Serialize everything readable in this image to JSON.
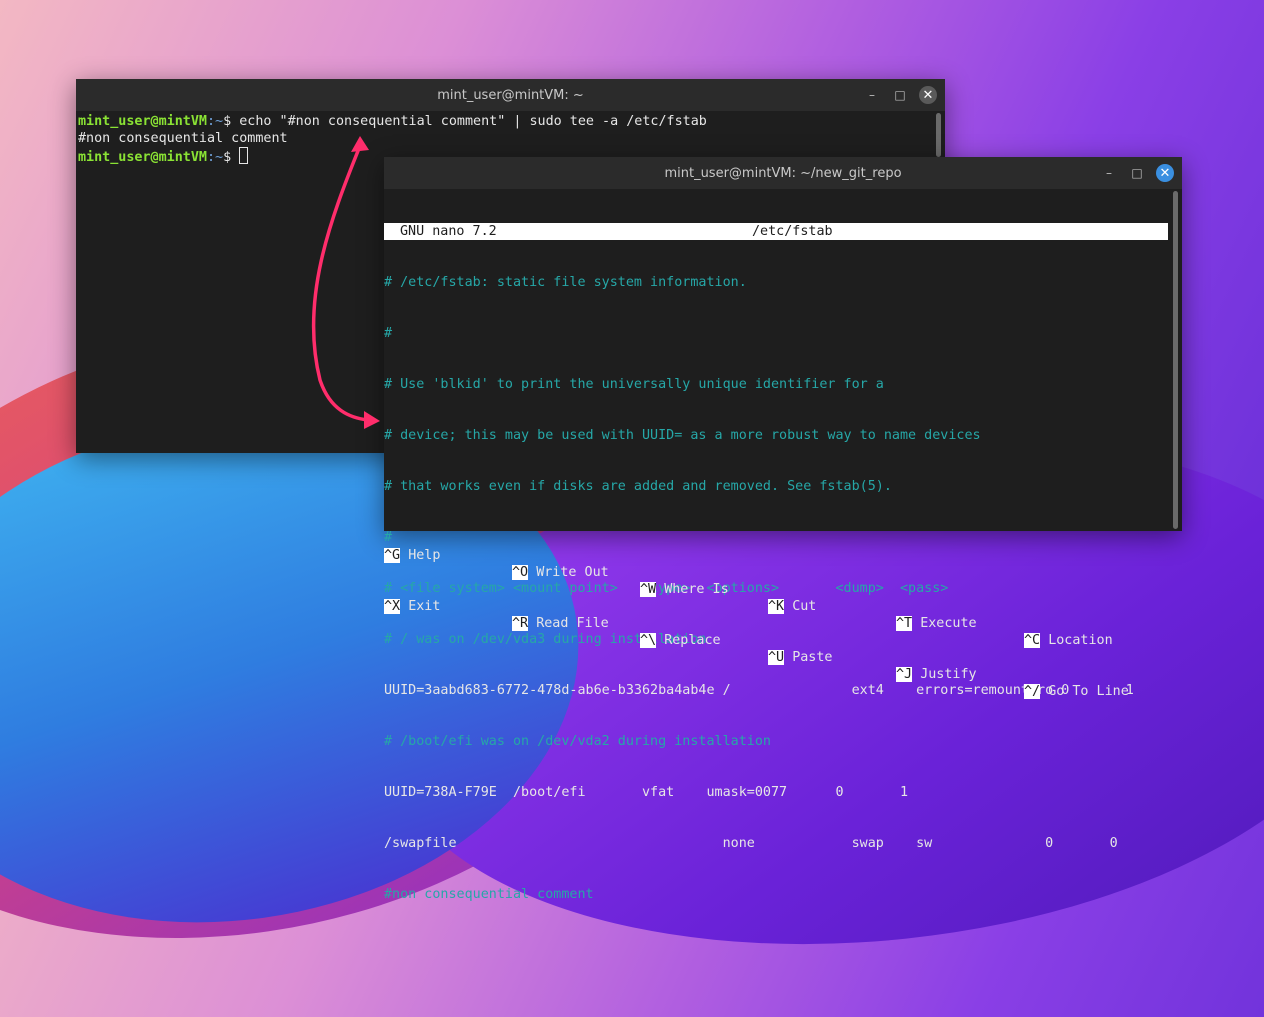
{
  "terminal1": {
    "title": "mint_user@mintVM: ~",
    "lines": [
      {
        "user": "mint_user@mintVM",
        "path": ":~",
        "prompt": "$ ",
        "command": "echo \"#non consequential comment\" | sudo tee -a /etc/fstab"
      },
      {
        "output": "#non consequential comment"
      },
      {
        "user": "mint_user@mintVM",
        "path": ":~",
        "prompt": "$ "
      }
    ]
  },
  "terminal2": {
    "title": "mint_user@mintVM: ~/new_git_repo",
    "nano_version": "GNU nano 7.2",
    "nano_file": "/etc/fstab",
    "lines": [
      "# /etc/fstab: static file system information.",
      "#",
      "# Use 'blkid' to print the universally unique identifier for a",
      "# device; this may be used with UUID= as a more robust way to name devices",
      "# that works even if disks are added and removed. See fstab(5).",
      "#",
      "# <file system> <mount point>   <type>  <options>       <dump>  <pass>",
      "# / was on /dev/vda3 during installation",
      "UUID=3aabd683-6772-478d-ab6e-b3362ba4ab4e /               ext4    errors=remount-ro 0       1",
      "# /boot/efi was on /dev/vda2 during installation",
      "UUID=738A-F79E  /boot/efi       vfat    umask=0077      0       1",
      "/swapfile                                 none            swap    sw              0       0",
      "#non consequential comment"
    ],
    "shortcuts_row1": [
      {
        "key": "^G",
        "label": "Help"
      },
      {
        "key": "^O",
        "label": "Write Out"
      },
      {
        "key": "^W",
        "label": "Where Is"
      },
      {
        "key": "^K",
        "label": "Cut"
      },
      {
        "key": "^T",
        "label": "Execute"
      },
      {
        "key": "^C",
        "label": "Location"
      }
    ],
    "shortcuts_row2": [
      {
        "key": "^X",
        "label": "Exit"
      },
      {
        "key": "^R",
        "label": "Read File"
      },
      {
        "key": "^\\",
        "label": "Replace"
      },
      {
        "key": "^U",
        "label": "Paste"
      },
      {
        "key": "^J",
        "label": "Justify"
      },
      {
        "key": "^/",
        "label": "Go To Line"
      }
    ]
  },
  "window_controls": {
    "minimize": "–",
    "maximize": "□",
    "close": "✕"
  },
  "colors": {
    "arrow": "#ff2d6b",
    "prompt_user": "#8ae234",
    "prompt_path": "#6fa0d8",
    "comment": "#26a7a7"
  }
}
